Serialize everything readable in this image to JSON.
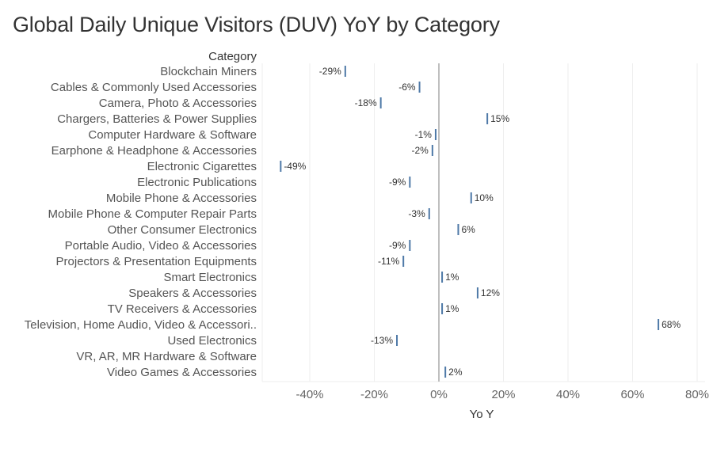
{
  "title": "Global Daily Unique Visitors (DUV) YoY by Category",
  "colors": {
    "mark": "#4e79a7",
    "zero_line": "#aaaaaa",
    "grid": "#eeeeee"
  },
  "chart_data": {
    "type": "scatter",
    "title": "Global Daily Unique Visitors (DUV) YoY by Category",
    "row_header": "Category",
    "xlabel": "Yo Y",
    "ylabel": "Category",
    "xlim": [
      -49,
      82
    ],
    "xticks": [
      -40,
      -20,
      0,
      20,
      40,
      60,
      80
    ],
    "xtick_labels": [
      "-40%",
      "-20%",
      "0%",
      "20%",
      "40%",
      "60%",
      "80%"
    ],
    "grid": true,
    "mark": "tick",
    "categories": [
      "Blockchain Miners",
      "Cables & Commonly Used Accessories",
      "Camera, Photo & Accessories",
      "Chargers, Batteries & Power Supplies",
      "Computer Hardware & Software",
      "Earphone & Headphone & Accessories",
      "Electronic Cigarettes",
      "Electronic Publications",
      "Mobile Phone & Accessories",
      "Mobile Phone & Computer Repair Parts",
      "Other Consumer Electronics",
      "Portable Audio, Video & Accessories",
      "Projectors & Presentation Equipments",
      "Smart Electronics",
      "Speakers & Accessories",
      "TV Receivers & Accessories",
      "Television, Home Audio, Video & Accessori..",
      "Used Electronics",
      "VR, AR, MR Hardware & Software",
      "Video Games & Accessories"
    ],
    "values": [
      -29,
      -6,
      -18,
      15,
      -1,
      -2,
      -49,
      -9,
      10,
      -3,
      6,
      -9,
      -11,
      1,
      12,
      1,
      68,
      -13,
      null,
      2
    ],
    "value_labels": [
      "-29%",
      "-6%",
      "-18%",
      "15%",
      "-1%",
      "-2%",
      "-49%",
      "-9%",
      "10%",
      "-3%",
      "6%",
      "-9%",
      "-11%",
      "1%",
      "12%",
      "1%",
      "68%",
      "-13%",
      "",
      "2%"
    ]
  }
}
